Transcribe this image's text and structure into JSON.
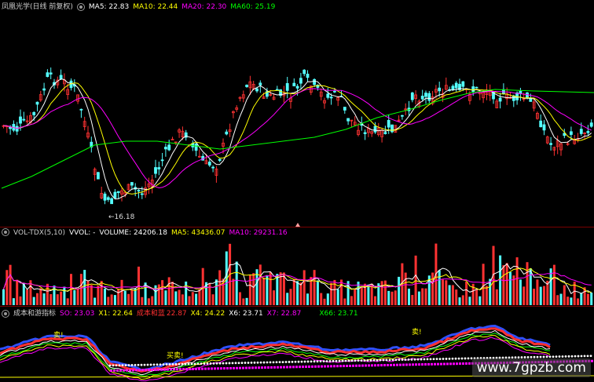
{
  "price_panel": {
    "title": "凤凰光学(日线 前复权)",
    "ma": [
      {
        "label": "MA5: 22.83",
        "color": "#ffffff"
      },
      {
        "label": "MA10: 22.44",
        "color": "#ffff00"
      },
      {
        "label": "MA20: 22.30",
        "color": "#ff00ff"
      },
      {
        "label": "MA60: 25.19",
        "color": "#00ff00"
      }
    ],
    "low_label": "16.18"
  },
  "volume_panel": {
    "items": [
      {
        "label": "VOL-TDX(5,10)",
        "color": "#cccccc"
      },
      {
        "label": "VVOL: -",
        "color": "#ffffff"
      },
      {
        "label": "VOLUME: 24206.18",
        "color": "#ffffff"
      },
      {
        "label": "MA5: 43436.07",
        "color": "#ffff00"
      },
      {
        "label": "MA10: 29231.16",
        "color": "#ff00ff"
      }
    ]
  },
  "indicator_panel": {
    "items": [
      {
        "label": "成本和游指标",
        "color": "#cccccc"
      },
      {
        "label": "SO: 23.03",
        "color": "#ff00ff"
      },
      {
        "label": "X1: 22.64",
        "color": "#ffff00"
      },
      {
        "label": "成本和蓝",
        "color": "#ff3030"
      },
      {
        "label": "22.87",
        "color": "#ff3030"
      },
      {
        "label": "X4: 24.22",
        "color": "#ffff00"
      },
      {
        "label": "X6: 23.71",
        "color": "#ffffff"
      },
      {
        "label": "X7: 22.87",
        "color": "#ff00ff"
      },
      {
        "label": "X66: 23.71",
        "color": "#00ff00"
      }
    ],
    "signals": [
      "卖!",
      "买卖!",
      "卖!"
    ]
  },
  "watermark": "www.7gpzb.com",
  "colors": {
    "up": "#ff3232",
    "down": "#54ffff",
    "bg": "#000000",
    "separator": "#7a0000"
  }
}
